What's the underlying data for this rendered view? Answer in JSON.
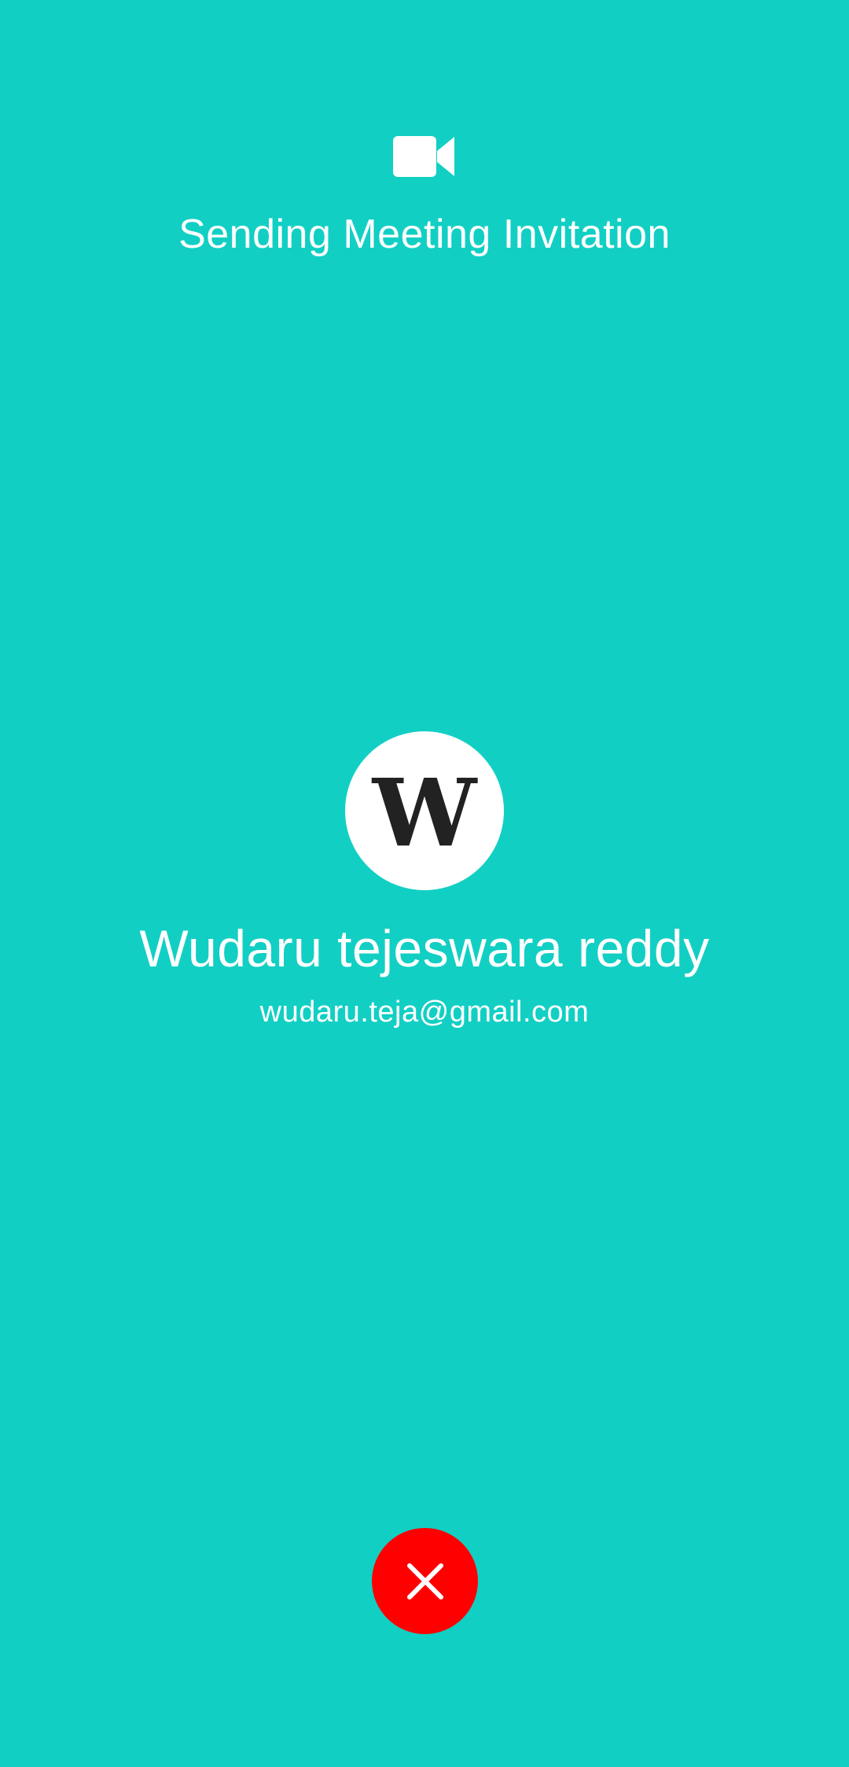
{
  "screen": {
    "title": "Sending Meeting Invitation",
    "header_icon": "video-camera-icon",
    "background_color": "#12cfc4"
  },
  "contact": {
    "initial": "W",
    "name": "Wudaru tejeswara reddy",
    "email": "wudaru.teja@gmail.com"
  },
  "end_button": {
    "icon": "close-icon",
    "color": "#ff0000"
  }
}
